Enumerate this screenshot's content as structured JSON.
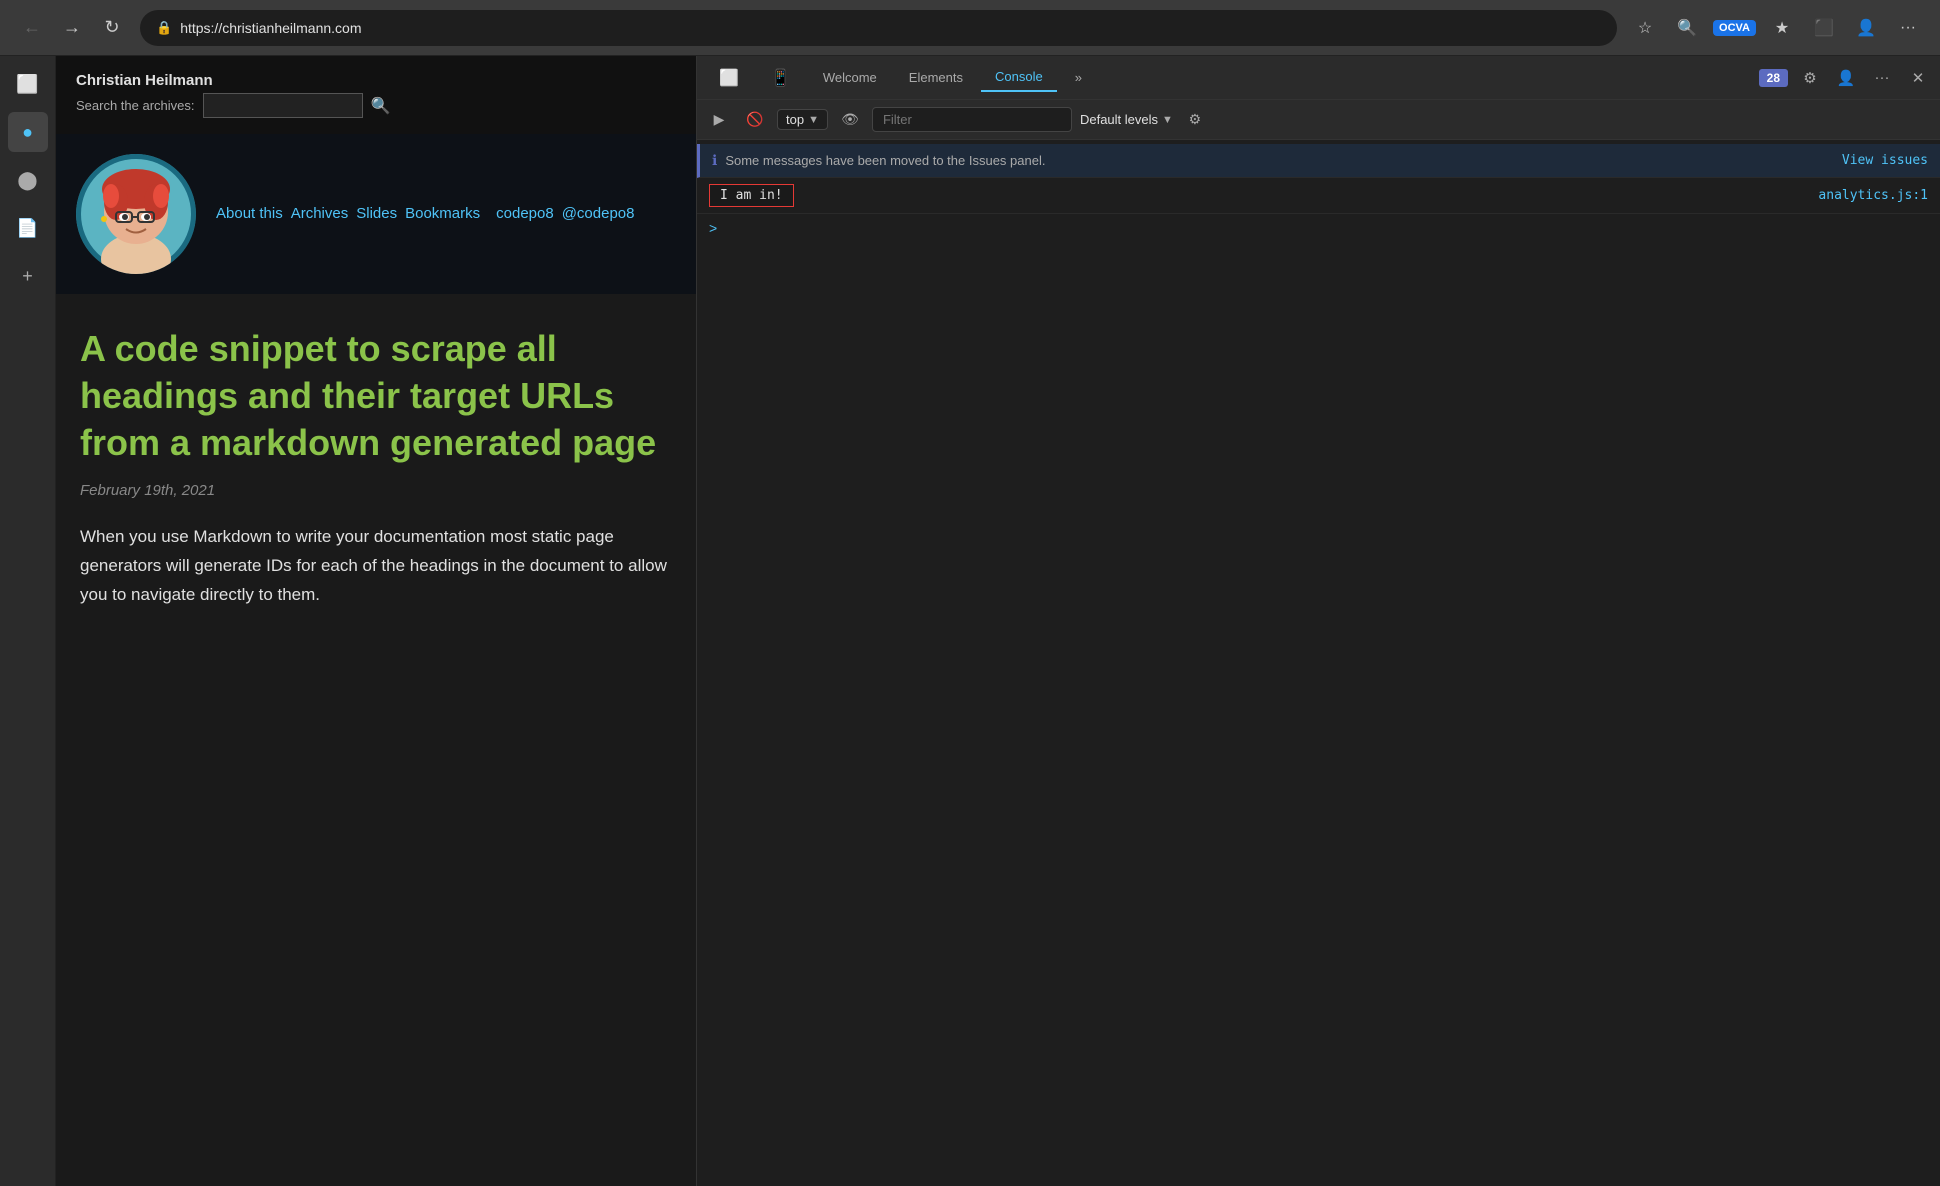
{
  "browser": {
    "url": "https://christianheilmann.com",
    "back_btn": "←",
    "forward_btn": "→",
    "refresh_btn": "↻",
    "lock_icon": "🔒",
    "extensions": {
      "star_icon": "☆",
      "ocva_label": "OCVA",
      "bookmarks_icon": "★",
      "screenshot_icon": "⬛",
      "person_icon": "👤",
      "more_icon": "···"
    },
    "close_icon": "✕"
  },
  "sidebar": {
    "tab_icon": "⬜",
    "extension_icon": "🔵",
    "github_icon": "⬤",
    "doc_icon": "📄",
    "add_icon": "+"
  },
  "site": {
    "header": {
      "title": "Christian Heilmann",
      "search_label": "Search the archives:",
      "search_placeholder": ""
    },
    "nav_links": [
      "About this",
      "Archives",
      "Slides",
      "Bookmarks",
      "codepo8",
      "@codepo8"
    ],
    "article": {
      "title": "A code snippet to scrape all headings and their target URLs from a markdown generated page",
      "date": "February 19th, 2021",
      "body": "When you use Markdown to write your documentation most static page generators will generate IDs for each of the headings in the document to allow you to navigate directly to them."
    }
  },
  "devtools": {
    "tabs": [
      "Welcome",
      "Elements",
      "Console",
      "»"
    ],
    "active_tab": "Console",
    "issues_count": "28",
    "toolbar_icons": {
      "settings": "⚙",
      "person": "👤",
      "more": "···",
      "close": "✕"
    },
    "console": {
      "run_icon": "▶",
      "ban_icon": "🚫",
      "context_label": "top",
      "eye_icon": "👁",
      "filter_placeholder": "Filter",
      "levels_label": "Default levels",
      "levels_chevron": "▼",
      "settings_icon": "⚙",
      "info_message": "Some messages have been moved to the Issues panel.",
      "view_issues_label": "View issues",
      "log_message": "I am in!",
      "log_source": "analytics.js:1",
      "prompt_icon": ">"
    }
  }
}
